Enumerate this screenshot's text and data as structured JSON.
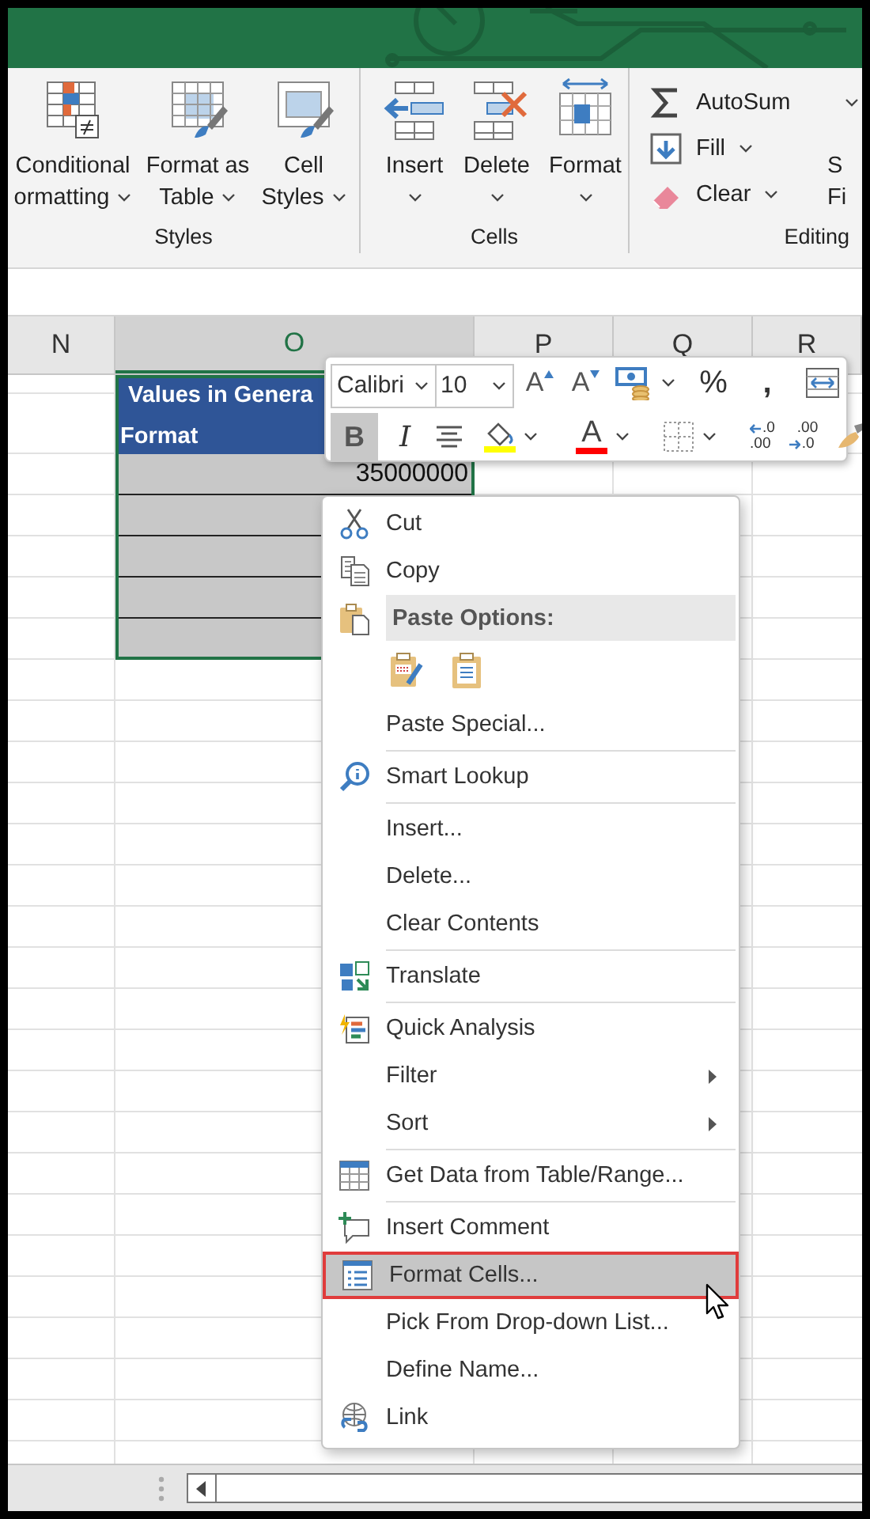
{
  "ribbon": {
    "groups": [
      {
        "label": "Styles",
        "buttons": [
          {
            "lines": [
              "Conditional",
              "ormatting"
            ],
            "dropdown": true
          },
          {
            "lines": [
              "Format as",
              "Table"
            ],
            "dropdown": true
          },
          {
            "lines": [
              "Cell",
              "Styles"
            ],
            "dropdown": true
          }
        ]
      },
      {
        "label": "Cells",
        "buttons": [
          {
            "lines": [
              "Insert"
            ],
            "dropdown": true
          },
          {
            "lines": [
              "Delete"
            ],
            "dropdown": true
          },
          {
            "lines": [
              "Format"
            ],
            "dropdown": true
          }
        ]
      },
      {
        "label": "Editing",
        "buttons": [
          {
            "lines": [
              "AutoSum"
            ],
            "dropdown": true
          },
          {
            "lines": [
              "Fill"
            ],
            "dropdown": true
          },
          {
            "lines": [
              "Clear"
            ],
            "dropdown": true
          }
        ]
      }
    ],
    "cut_button": {
      "lines": [
        "S",
        "Fi"
      ]
    }
  },
  "sheet": {
    "columns": [
      {
        "label": "N",
        "selected": false
      },
      {
        "label": "O",
        "selected": true
      },
      {
        "label": "P",
        "selected": false
      },
      {
        "label": "Q",
        "selected": false
      },
      {
        "label": "R",
        "selected": false
      }
    ],
    "cells": [
      {
        "kind": "header",
        "text": "Values in Genera\nFormat"
      },
      {
        "kind": "value",
        "text": "35000000"
      },
      {
        "kind": "value"
      },
      {
        "kind": "value"
      },
      {
        "kind": "value"
      },
      {
        "kind": "value"
      }
    ]
  },
  "mini_toolbar": {
    "font": "Calibri",
    "size": "10",
    "row1": [
      {
        "kind": "grow",
        "text": "A"
      },
      {
        "kind": "shrink",
        "text": "A"
      },
      {
        "kind": "accounting",
        "dropdown": true
      },
      {
        "kind": "text",
        "text": "%"
      },
      {
        "kind": "text",
        "text": ","
      },
      {
        "kind": "wrap"
      }
    ],
    "row2": [
      {
        "kind": "bold",
        "text": "B",
        "on": true
      },
      {
        "kind": "italic",
        "text": "I",
        "on": false
      },
      {
        "kind": "center"
      },
      {
        "kind": "fill",
        "color": "#ffff00",
        "dropdown": true
      },
      {
        "kind": "font-color",
        "text": "A",
        "color": "#ff0000",
        "dropdown": true
      },
      {
        "kind": "borders",
        "dropdown": true
      },
      {
        "kind": "increase-decimal",
        "top": ".0",
        "bottom": ".00"
      },
      {
        "kind": "decrease-decimal",
        "top": ".00",
        "bottom": ".0"
      },
      {
        "kind": "painter"
      }
    ]
  },
  "context_menu": {
    "items": [
      {
        "kind": "item",
        "label": "Cut",
        "divider": false,
        "submenu": false,
        "selected": false
      },
      {
        "kind": "item",
        "label": "Copy",
        "divider": false,
        "submenu": false,
        "selected": false
      },
      {
        "kind": "header",
        "label": "Paste Options:"
      },
      {
        "kind": "paste-icons"
      },
      {
        "kind": "item",
        "label": "Paste Special...",
        "divider": false,
        "submenu": false,
        "selected": false
      },
      {
        "kind": "item",
        "label": "Smart Lookup",
        "divider": true,
        "submenu": false,
        "selected": false
      },
      {
        "kind": "item",
        "label": "Insert...",
        "divider": true,
        "submenu": false,
        "selected": false
      },
      {
        "kind": "item",
        "label": "Delete...",
        "divider": false,
        "submenu": false,
        "selected": false
      },
      {
        "kind": "item",
        "label": "Clear Contents",
        "divider": false,
        "submenu": false,
        "selected": false
      },
      {
        "kind": "item",
        "label": "Translate",
        "divider": true,
        "submenu": false,
        "selected": false
      },
      {
        "kind": "item",
        "label": "Quick Analysis",
        "divider": true,
        "submenu": false,
        "selected": false
      },
      {
        "kind": "item",
        "label": "Filter",
        "divider": false,
        "submenu": true,
        "selected": false
      },
      {
        "kind": "item",
        "label": "Sort",
        "divider": false,
        "submenu": true,
        "selected": false
      },
      {
        "kind": "item",
        "label": "Get Data from Table/Range...",
        "divider": true,
        "submenu": false,
        "selected": false
      },
      {
        "kind": "item",
        "label": "Insert Comment",
        "divider": true,
        "submenu": false,
        "selected": false
      },
      {
        "kind": "item",
        "label": "Format Cells...",
        "divider": false,
        "submenu": false,
        "selected": true
      },
      {
        "kind": "item",
        "label": "Pick From Drop-down List...",
        "divider": false,
        "submenu": false,
        "selected": false
      },
      {
        "kind": "item",
        "label": "Define Name...",
        "divider": false,
        "submenu": false,
        "selected": false
      },
      {
        "kind": "item",
        "label": "Link",
        "divider": false,
        "submenu": false,
        "selected": false
      }
    ]
  }
}
